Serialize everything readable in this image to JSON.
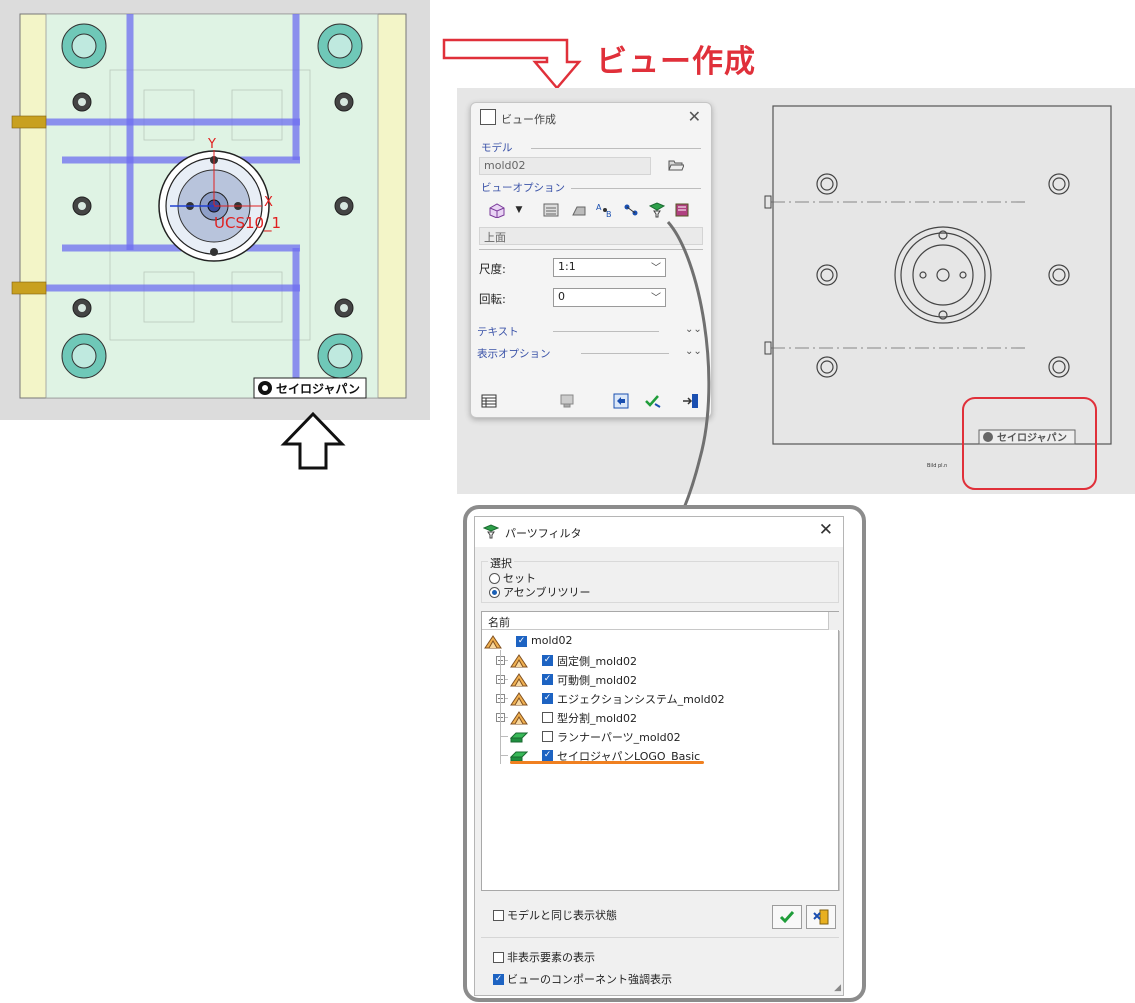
{
  "callout": {
    "title": "ビュー作成"
  },
  "cad": {
    "ucs_label": "UCS10_1",
    "axis_x": "X",
    "axis_y": "Y",
    "logo_text": "セイロジャパン"
  },
  "drawing": {
    "logo_text": "セイロジャパン",
    "small_label": "Bild pl.n"
  },
  "view_panel": {
    "title": "ビュー作成",
    "model_label": "モデル",
    "model_value": "mold02",
    "view_options_label": "ビューオプション",
    "view_value": "上面",
    "scale_label": "尺度:",
    "scale_value": "1:1",
    "rotation_label": "回転:",
    "rotation_value": "0",
    "text_label": "テキスト",
    "display_options_label": "表示オプション"
  },
  "parts_filter": {
    "title": "パーツフィルタ",
    "selection_label": "選択",
    "radio_set": "セット",
    "radio_assembly_tree": "アセンブリツリー",
    "column_name": "名前",
    "tree": [
      {
        "label": "mold02",
        "checked": true,
        "level": 0,
        "expandable": false
      },
      {
        "label": "固定側_mold02",
        "checked": true,
        "level": 1,
        "expandable": true
      },
      {
        "label": "可動側_mold02",
        "checked": true,
        "level": 1,
        "expandable": true
      },
      {
        "label": "エジェクションシステム_mold02",
        "checked": true,
        "level": 1,
        "expandable": true
      },
      {
        "label": "型分割_mold02",
        "checked": false,
        "level": 1,
        "expandable": true
      },
      {
        "label": "ランナーパーツ_mold02",
        "checked": false,
        "level": 1,
        "expandable": false
      },
      {
        "label": "セイロジャパンLOGO_Basic",
        "checked": true,
        "level": 1,
        "expandable": false
      }
    ],
    "opt_same_display": "モデルと同じ表示状態",
    "opt_show_hidden": "非表示要素の表示",
    "opt_highlight": "ビューのコンポーネント強調表示",
    "opt_same_display_checked": false,
    "opt_show_hidden_checked": false,
    "opt_highlight_checked": true
  },
  "colors": {
    "accent_red": "#e0303a",
    "highlight_orange": "#f08020",
    "check_blue": "#1d63c2",
    "pipe_blue": "#6d6df0"
  }
}
